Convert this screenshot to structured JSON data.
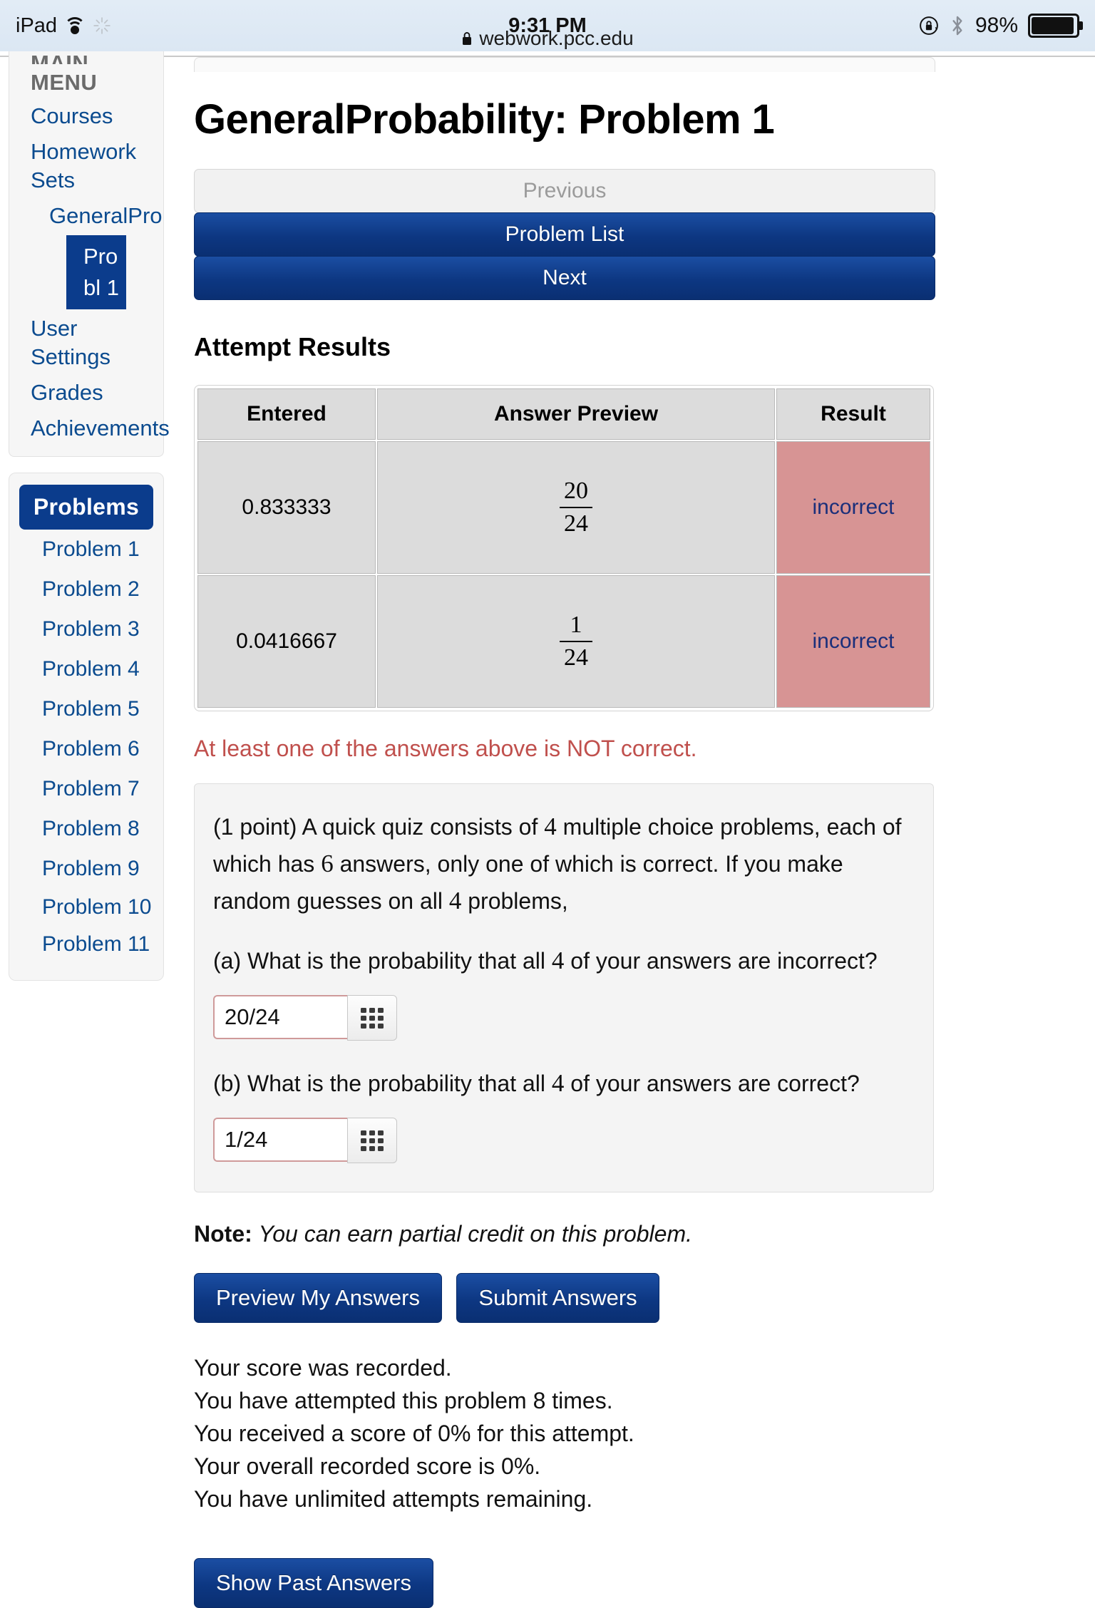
{
  "statusbar": {
    "device": "iPad",
    "time": "9:31 PM",
    "battery_pct": "98%",
    "icons": [
      "wifi-icon",
      "brightness-icon",
      "rotation-lock-icon",
      "bluetooth-icon",
      "battery-icon"
    ]
  },
  "browser": {
    "url": "webwork.pcc.edu",
    "lock_icon": "lock-icon"
  },
  "sidebar": {
    "main_cut_label": "MAIN",
    "menu_label": "MENU",
    "items": [
      {
        "label": "Courses"
      },
      {
        "label": "Homework Sets"
      },
      {
        "label": "GeneralPro"
      },
      {
        "label": "Probl 1",
        "active": true
      },
      {
        "label": "User Settings"
      },
      {
        "label": "Grades"
      },
      {
        "label": "Achievements"
      }
    ],
    "problems_panel": {
      "header": "Problems",
      "items": [
        "Problem 1",
        "Problem 2",
        "Problem 3",
        "Problem 4",
        "Problem 5",
        "Problem 6",
        "Problem 7",
        "Problem 8",
        "Problem 9",
        "Problem 10",
        "Problem 11"
      ]
    }
  },
  "main": {
    "title": "GeneralProbability: Problem 1",
    "nav": {
      "previous": "Previous",
      "problem_list": "Problem List",
      "next": "Next"
    },
    "attempt_results": {
      "heading": "Attempt Results",
      "columns": [
        "Entered",
        "Answer Preview",
        "Result"
      ],
      "rows": [
        {
          "entered": "0.833333",
          "preview_num": "20",
          "preview_den": "24",
          "result": "incorrect"
        },
        {
          "entered": "0.0416667",
          "preview_num": "1",
          "preview_den": "24",
          "result": "incorrect"
        }
      ],
      "result_bg": "#d79494",
      "result_fg": "#1b2f7a"
    },
    "error_message": "At least one of the answers above is NOT correct.",
    "problem": {
      "points": "(1 point)",
      "stem_part1": "A quick quiz consists of",
      "stem_n1": "4",
      "stem_part2": "multiple choice problems, each of which has",
      "stem_n2": "6",
      "stem_part3": "answers, only one of which is correct. If you make random guesses on all",
      "stem_n3": "4",
      "stem_part4": "problems,",
      "parts": [
        {
          "label": "(a) What is the probability that all",
          "num": "4",
          "label_end": "of your answers are incorrect?",
          "answer_value": "20/24",
          "keypad_icon": "keypad-icon"
        },
        {
          "label": "(b) What is the probability that all",
          "num": "4",
          "label_end": "of your answers are correct?",
          "answer_value": "1/24",
          "keypad_icon": "keypad-icon"
        }
      ]
    },
    "note_label": "Note:",
    "note_text": "You can earn partial credit on this problem.",
    "buttons": {
      "preview": "Preview My Answers",
      "submit": "Submit Answers",
      "show_past": "Show Past Answers"
    },
    "score_lines": [
      "Your score was recorded.",
      "You have attempted this problem 8 times.",
      "You received a score of 0% for this attempt.",
      "Your overall recorded score is 0%.",
      "You have unlimited attempts remaining."
    ]
  },
  "colors": {
    "accent_blue": "#0b3c8c",
    "link_blue": "#0b4b8f",
    "error_red": "#c0504d",
    "incorrect_bg": "#d79494"
  }
}
